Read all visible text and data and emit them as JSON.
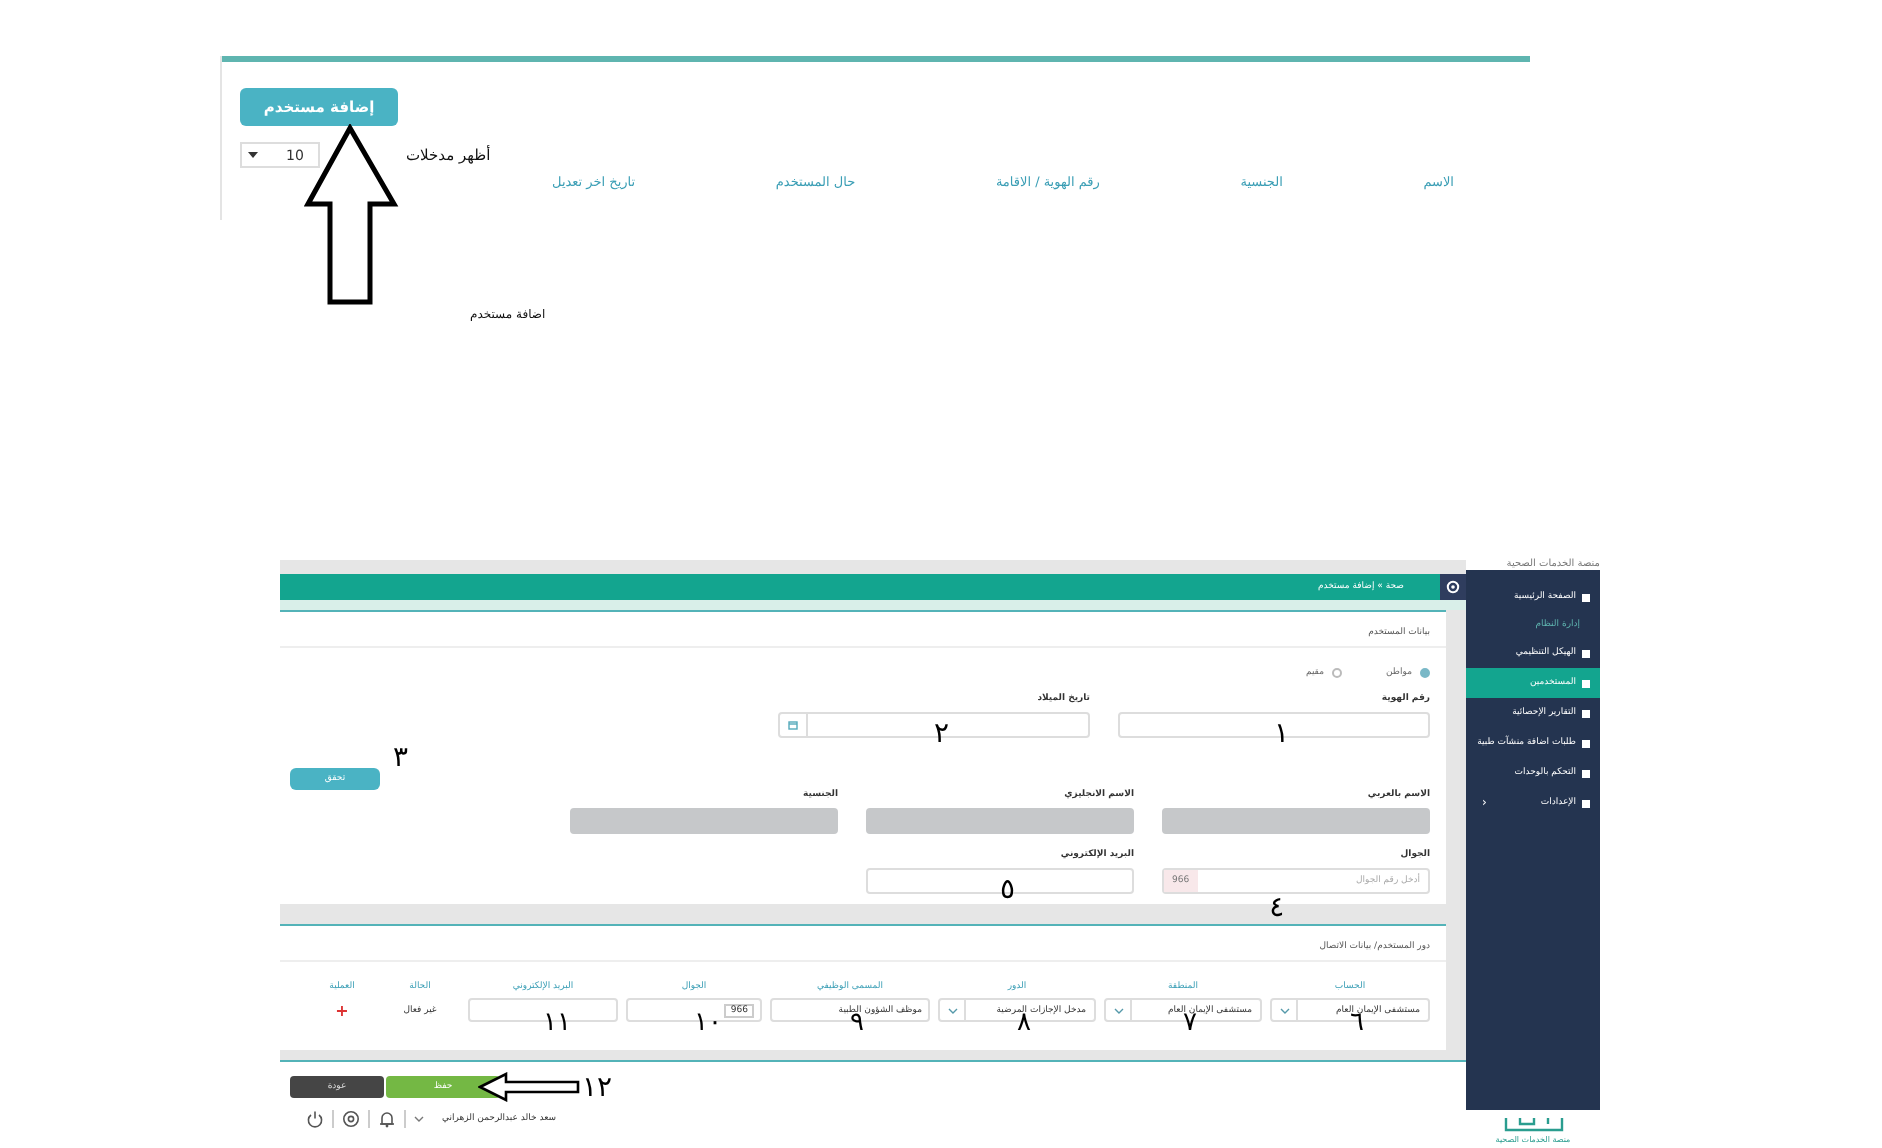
{
  "list_screen": {
    "add_button": "إضافة مستخدم",
    "page_size_label": "أظهر مدخلات",
    "page_size": "10",
    "columns": [
      "الاسم",
      "الجنسية",
      "رقم الهوية / الاقامة",
      "حال المستخدم",
      "تاريخ اخر تعديل"
    ]
  },
  "caption": "اضافة مستخدم",
  "form_screen": {
    "brand": "منصة الخدمات الصحية",
    "sidebar": [
      {
        "label": "الصفحة الرئيسية",
        "kind": "link",
        "selected": false
      },
      {
        "label": "إدارة النظام",
        "kind": "section",
        "selected": false
      },
      {
        "label": "الهيكل التنظيمي",
        "kind": "link",
        "selected": false
      },
      {
        "label": "المستخدمين",
        "kind": "link",
        "selected": true
      },
      {
        "label": "التقارير الإحصائية",
        "kind": "link",
        "selected": false
      },
      {
        "label": "طلبات اضافة منشآت طبية",
        "kind": "link",
        "selected": false
      },
      {
        "label": "التحكم بالوحدات",
        "kind": "link",
        "selected": false
      },
      {
        "label": "الإعدادات",
        "kind": "group",
        "selected": false,
        "chevron": "‹"
      }
    ],
    "logo_caption": "منصة الخدمات الصحية",
    "breadcrumb": "صحة » إضافة مستخدم",
    "user_card": {
      "title": "بيانات المستخدم",
      "residency": [
        {
          "label": "مواطن",
          "selected": true
        },
        {
          "label": "مقيم",
          "selected": false
        }
      ],
      "rows": [
        [
          {
            "label": "رقم الهوية",
            "kind": "text",
            "annotation": "١"
          },
          {
            "label": "تاريخ الميلاد",
            "kind": "date",
            "annotation": "٢"
          }
        ],
        [
          {
            "label": "الاسم بالعربي",
            "kind": "readonly"
          },
          {
            "label": "الاسم الانجليزي",
            "kind": "readonly"
          },
          {
            "label": "الجنسية",
            "kind": "readonly"
          }
        ],
        [
          {
            "label": "الجوال",
            "kind": "phone",
            "prefix": "966",
            "placeholder": "أدخل رقم الجوال",
            "annotation": "٤"
          },
          {
            "label": "البريد الإلكتروني",
            "kind": "text",
            "annotation": "٥"
          }
        ]
      ],
      "verify_button": "تحقق",
      "verify_annotation": "٣"
    },
    "role_card": {
      "title": "دور المستخدم/ بيانات الاتصال",
      "columns": [
        "الحساب",
        "المنطقة",
        "الدور",
        "المسمى الوظيفي",
        "الجوال",
        "البريد الإلكتروني",
        "الحالة",
        "العملية"
      ],
      "cells": [
        {
          "kind": "select",
          "value": "مستشفى الإيمان العام",
          "annotation": "٦"
        },
        {
          "kind": "select",
          "value": "مستشفى الإيمان العام",
          "annotation": "٧"
        },
        {
          "kind": "select",
          "value": "مدخل الإجازات المرضية",
          "annotation": "٨"
        },
        {
          "kind": "text",
          "value": "موظف الشؤون الطبية",
          "annotation": "٩"
        },
        {
          "kind": "phone",
          "prefix": "966",
          "annotation": "١٠"
        },
        {
          "kind": "text",
          "annotation": "١١"
        },
        {
          "kind": "label",
          "value": "غير فعال"
        },
        {
          "kind": "add",
          "value": "+"
        }
      ]
    },
    "back_button": "عودة",
    "save_button": "حفظ",
    "save_annotation": "١٢",
    "footer": {
      "user": "سعد خالد عبدالرحمن الزهراني"
    }
  }
}
